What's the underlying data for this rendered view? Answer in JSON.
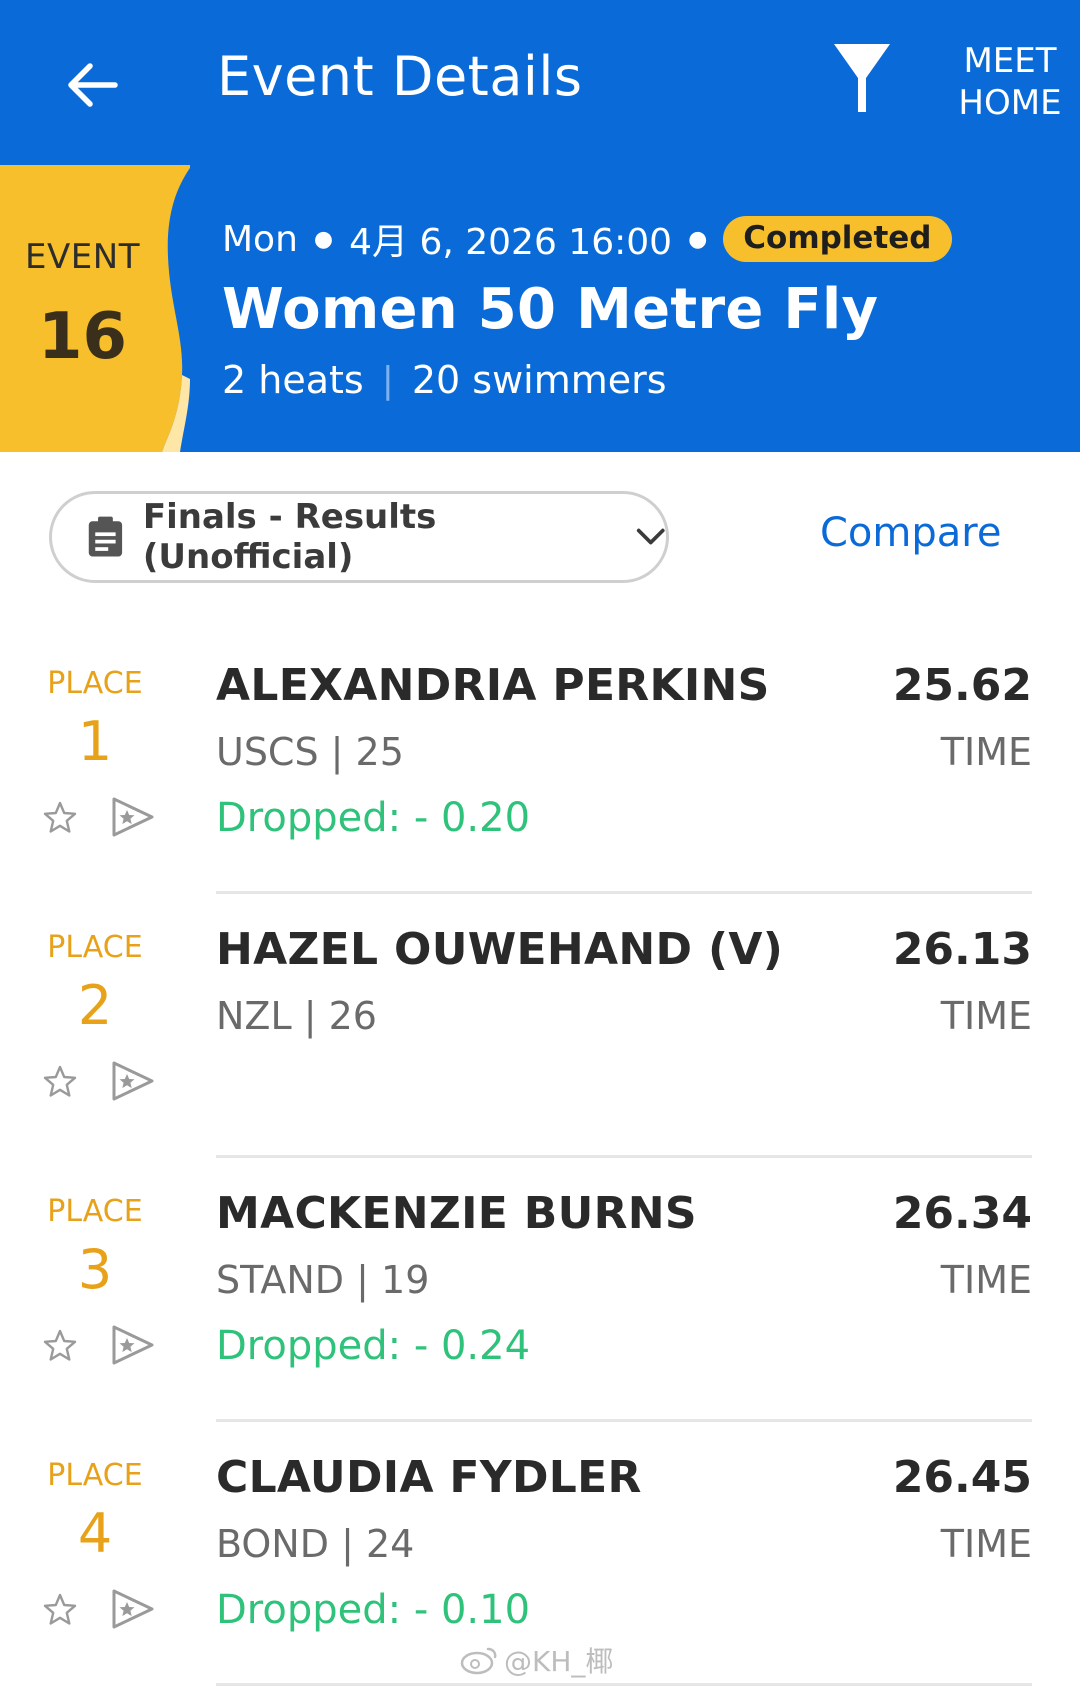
{
  "topbar": {
    "title": "Event Details",
    "meet_home_line1": "MEET",
    "meet_home_line2": "HOME"
  },
  "event": {
    "label": "EVENT",
    "number": "16",
    "day": "Mon",
    "datetime": "4月 6, 2026 16:00",
    "status": "Completed",
    "name": "Women 50 Metre Fly",
    "heats": "2 heats",
    "swimmers": "20 swimmers"
  },
  "selector": {
    "label": "Finals - Results (Unofficial)",
    "compare": "Compare"
  },
  "results": [
    {
      "place_label": "PLACE",
      "place": "1",
      "name": "ALEXANDRIA PERKINS",
      "team": "USCS | 25",
      "dropped": "Dropped: - 0.20",
      "time": "25.62",
      "time_label": "TIME"
    },
    {
      "place_label": "PLACE",
      "place": "2",
      "name": "HAZEL OUWEHAND (V)",
      "team": "NZL | 26",
      "dropped": "",
      "time": "26.13",
      "time_label": "TIME"
    },
    {
      "place_label": "PLACE",
      "place": "3",
      "name": "MACKENZIE BURNS",
      "team": "STAND | 19",
      "dropped": "Dropped: - 0.24",
      "time": "26.34",
      "time_label": "TIME"
    },
    {
      "place_label": "PLACE",
      "place": "4",
      "name": "CLAUDIA FYDLER",
      "team": "BOND | 24",
      "dropped": "Dropped: - 0.10",
      "time": "26.45",
      "time_label": "TIME"
    }
  ],
  "watermark": "@KH_椰",
  "colors": {
    "primary": "#0a6bd8",
    "accent": "#f7bf2b",
    "place": "#e7a21a",
    "dropped": "#2fc27a"
  },
  "icons": {
    "back": "arrow-left-icon",
    "filter": "filter-icon",
    "selector": "clipboard-icon",
    "chevron": "chevron-down-icon",
    "favorite": "star-icon",
    "video": "play-icon"
  }
}
